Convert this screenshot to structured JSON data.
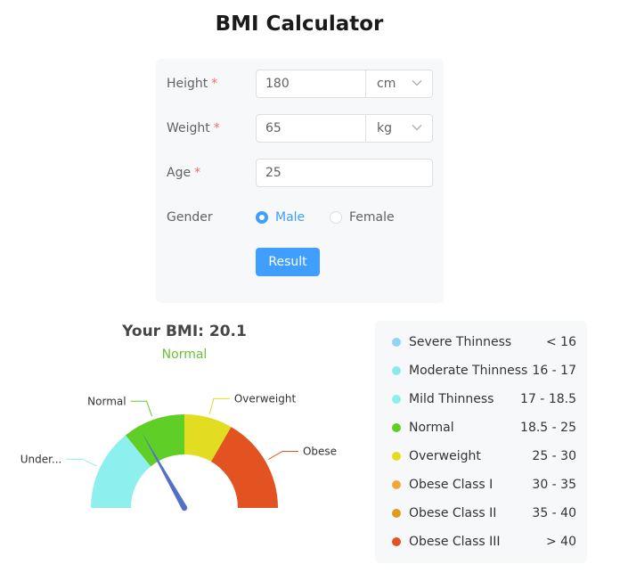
{
  "title": "BMI Calculator",
  "form": {
    "height": {
      "label": "Height",
      "required_mark": "*",
      "value": "180",
      "unit": "cm"
    },
    "weight": {
      "label": "Weight",
      "required_mark": "*",
      "value": "65",
      "unit": "kg"
    },
    "age": {
      "label": "Age",
      "required_mark": "*",
      "value": "25"
    },
    "gender": {
      "label": "Gender",
      "options": [
        {
          "label": "Male",
          "selected": true
        },
        {
          "label": "Female",
          "selected": false
        }
      ]
    },
    "submit_label": "Result"
  },
  "result": {
    "bmi_text": "Your BMI: 20.1",
    "category": "Normal",
    "category_color": "#67c23a"
  },
  "gauge": {
    "value": 20.1,
    "min": 10,
    "max": 40,
    "needle_color": "#5470c6",
    "segments": [
      {
        "name": "Under...",
        "from": 10,
        "to": 18.5,
        "color": "#8ef0ee"
      },
      {
        "name": "Normal",
        "from": 18.5,
        "to": 25,
        "color": "#5fce26"
      },
      {
        "name": "Overweight",
        "from": 25,
        "to": 30,
        "color": "#e2dd20"
      },
      {
        "name": "Obese",
        "from": 30,
        "to": 40,
        "color": "#e35221"
      }
    ]
  },
  "legend": [
    {
      "name": "Severe Thinness",
      "range": "< 16",
      "color": "#91d5f5"
    },
    {
      "name": "Moderate Thinness",
      "range": "16 - 17",
      "color": "#8ee8f0"
    },
    {
      "name": "Mild Thinness",
      "range": "17 - 18.5",
      "color": "#8ef0ea"
    },
    {
      "name": "Normal",
      "range": "18.5 - 25",
      "color": "#5fce26"
    },
    {
      "name": "Overweight",
      "range": "25 - 30",
      "color": "#e2dd20"
    },
    {
      "name": "Obese Class I",
      "range": "30 - 35",
      "color": "#f0a83c"
    },
    {
      "name": "Obese Class II",
      "range": "35 - 40",
      "color": "#e29a1e"
    },
    {
      "name": "Obese Class III",
      "range": "> 40",
      "color": "#e35221"
    }
  ]
}
